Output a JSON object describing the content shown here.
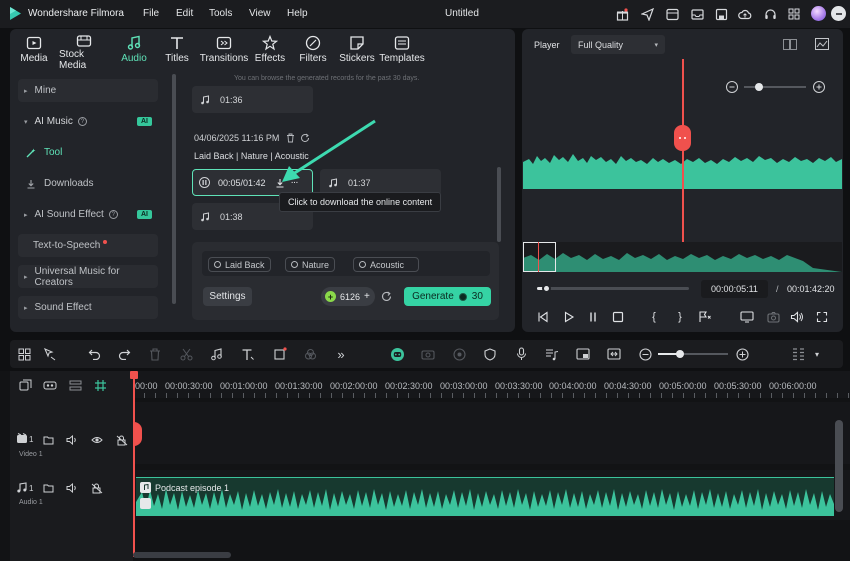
{
  "app": {
    "name": "Wondershare Filmora",
    "title": "Untitled"
  },
  "menu": [
    "File",
    "Edit",
    "Tools",
    "View",
    "Help"
  ],
  "titlebar_icons": [
    "gift-icon",
    "send-icon",
    "layout-icon",
    "inbox-icon",
    "save-icon",
    "cloud-upload-icon",
    "headset-icon",
    "grid-icon",
    "avatar",
    "minimize-icon"
  ],
  "tabs": [
    {
      "id": "media",
      "label": "Media",
      "icon": "media-icon"
    },
    {
      "id": "stock",
      "label": "Stock Media",
      "icon": "stock-media-icon"
    },
    {
      "id": "audio",
      "label": "Audio",
      "icon": "music-note-icon",
      "active": true
    },
    {
      "id": "titles",
      "label": "Titles",
      "icon": "titles-icon"
    },
    {
      "id": "transitions",
      "label": "Transitions",
      "icon": "transitions-icon"
    },
    {
      "id": "effects",
      "label": "Effects",
      "icon": "effects-icon"
    },
    {
      "id": "filters",
      "label": "Filters",
      "icon": "filters-icon"
    },
    {
      "id": "stickers",
      "label": "Stickers",
      "icon": "stickers-icon"
    },
    {
      "id": "templates",
      "label": "Templates",
      "icon": "templates-icon"
    }
  ],
  "sidebar": {
    "mine": "Mine",
    "ai_music": "AI Music",
    "ai_badge": "AI",
    "tool": "Tool",
    "downloads": "Downloads",
    "ai_sound_effect": "AI Sound Effect",
    "text_to_speech": "Text-to-Speech",
    "universal_music": "Universal Music for Creators",
    "sound_effect": "Sound Effect"
  },
  "music": {
    "history_note": "You can browse the generated records for the past 30 days.",
    "top_duration": "01:36",
    "date": "04/06/2025 11:16 PM",
    "tags_line": "Laid Back | Nature | Acoustic",
    "playing_time": "00:05/01:42",
    "item2_duration": "01:37",
    "item3_duration": "01:38",
    "tooltip": "Click to download the online content",
    "chips": [
      "Laid Back",
      "Nature",
      "Acoustic"
    ],
    "settings": "Settings",
    "credits": "6126",
    "generate": "Generate",
    "generate_cost": "30"
  },
  "player": {
    "label": "Player",
    "quality": "Full Quality",
    "current_time": "00:00:05:11",
    "separator": "/",
    "total_time": "00:01:42:20"
  },
  "timeline": {
    "ticks": [
      "00:00",
      "00:00:30:00",
      "00:01:00:00",
      "00:01:30:00",
      "00:02:00:00",
      "00:02:30:00",
      "00:03:00:00",
      "00:03:30:00",
      "00:04:00:00",
      "00:04:30:00",
      "00:05:00:00",
      "00:05:30:00",
      "00:06:00:00"
    ],
    "video_track": {
      "num": "1",
      "label": "Video 1"
    },
    "audio_track": {
      "num": "1",
      "label": "Audio 1"
    },
    "clip_name": "Podcast episode 1"
  },
  "colors": {
    "accent": "#35d3a4",
    "waveform": "#3cc39c",
    "playhead": "#f0514d",
    "background": "#0f1012",
    "panel": "#222429"
  }
}
